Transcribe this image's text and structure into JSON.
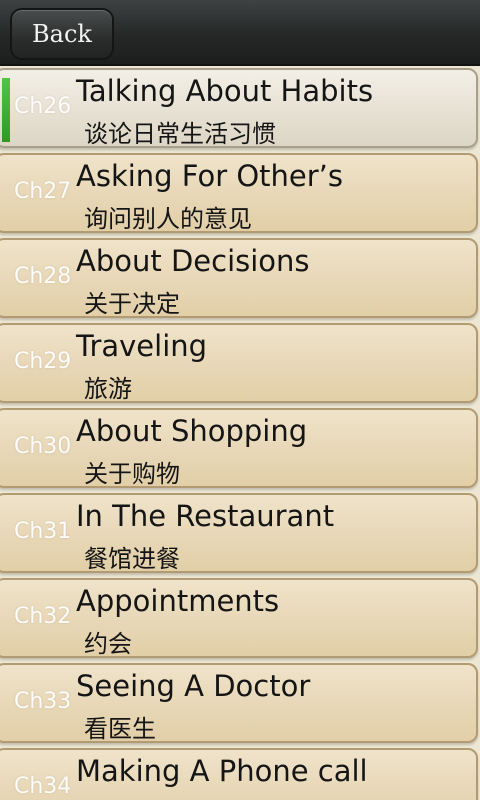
{
  "header": {
    "back_label": "Back"
  },
  "chapters": [
    {
      "num": "Ch26",
      "title": "Talking About Habits",
      "subtitle": "谈论日常生活习惯"
    },
    {
      "num": "Ch27",
      "title": "Asking For Other’s",
      "subtitle": "询问别人的意见"
    },
    {
      "num": "Ch28",
      "title": "About Decisions",
      "subtitle": "关于决定"
    },
    {
      "num": "Ch29",
      "title": "Traveling",
      "subtitle": "旅游"
    },
    {
      "num": "Ch30",
      "title": "About Shopping",
      "subtitle": "关于购物"
    },
    {
      "num": "Ch31",
      "title": "In The Restaurant",
      "subtitle": "餐馆进餐"
    },
    {
      "num": "Ch32",
      "title": "Appointments",
      "subtitle": "约会"
    },
    {
      "num": "Ch33",
      "title": "Seeing A Doctor",
      "subtitle": "看医生"
    },
    {
      "num": "Ch34",
      "title": "Making A Phone call",
      "subtitle": ""
    }
  ],
  "colors": {
    "selected_indicator": "#3fb32e",
    "row_bg": "#e7d6b5",
    "topbar_bg": "#262828"
  }
}
